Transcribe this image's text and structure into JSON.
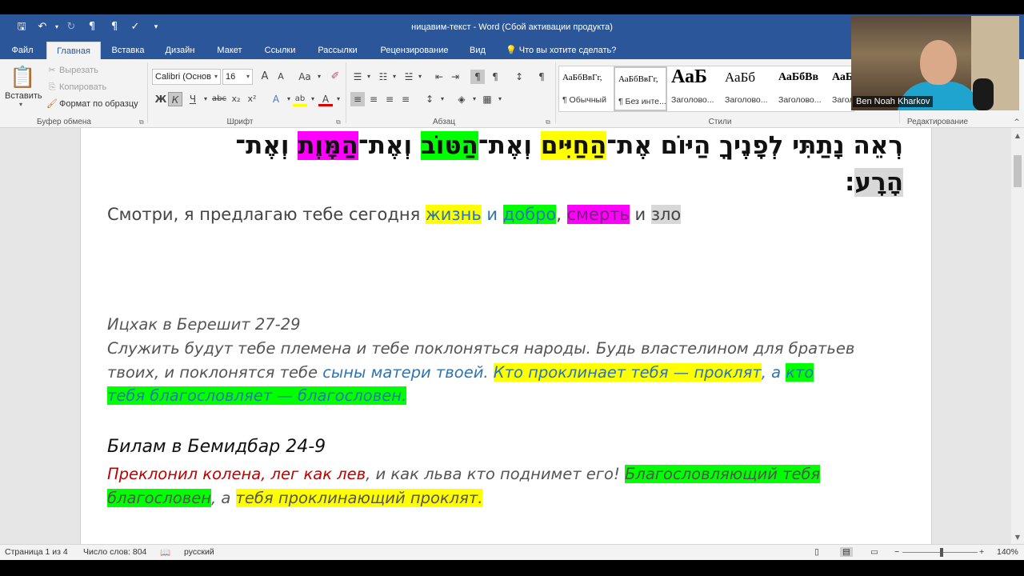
{
  "titlebar": {
    "title": "ницавим-текст - Word (Сбой активации продукта)"
  },
  "tabs": [
    {
      "label": "Файл"
    },
    {
      "label": "Главная"
    },
    {
      "label": "Вставка"
    },
    {
      "label": "Дизайн"
    },
    {
      "label": "Макет"
    },
    {
      "label": "Ссылки"
    },
    {
      "label": "Рассылки"
    },
    {
      "label": "Рецензирование"
    },
    {
      "label": "Вид"
    }
  ],
  "tell_me": "Что вы хотите сделать?",
  "clipboard": {
    "paste": "Вставить",
    "cut": "Вырезать",
    "copy": "Копировать",
    "format_painter": "Формат по образцу",
    "group": "Буфер обмена"
  },
  "font": {
    "name": "Calibri (Основ",
    "size": "16",
    "group": "Шрифт",
    "bold": "Ж",
    "italic": "К",
    "underline": "Ч",
    "strike": "abc",
    "sub": "x₂",
    "sup": "x²",
    "grow": "A",
    "shrink": "A",
    "case": "Аа",
    "text_effects": "A",
    "highlight": "ab",
    "font_color": "A"
  },
  "paragraph": {
    "group": "Абзац"
  },
  "styles": {
    "group": "Стили",
    "items": [
      {
        "sample": "АаБбВвГг,",
        "name": "¶ Обычный"
      },
      {
        "sample": "АаБбВвГг,",
        "name": "¶ Без инте..."
      },
      {
        "sample": "АаБ",
        "name": "Заголово..."
      },
      {
        "sample": "АаБб",
        "name": "Заголово..."
      },
      {
        "sample": "АаБбВв",
        "name": "Заголово..."
      },
      {
        "sample": "АаБ",
        "name": "Загол"
      }
    ]
  },
  "editing": {
    "group": "Редактирование"
  },
  "webcam": {
    "name": "Ben Noah Kharkov"
  },
  "document": {
    "hebrew": {
      "line1": {
        "p1": "רְאֵה נָתַתִּי לְפָנֶיךָ הַיּוֹם אֶת־",
        "p2": "הַחַיִּים",
        "p3": " וְאֶת־",
        "p4": "הַטּוֹב",
        "p5": " וְאֶת־",
        "p6": "הַמָּוֶת",
        "p7": " וְאֶת־"
      },
      "line2": {
        "p1": "הָרָע",
        "p2": ":"
      }
    },
    "translation": {
      "p1": "Смотри, я предлагаю тебе сегодня ",
      "p2": "жизнь",
      "p3": " и ",
      "p4": "добро",
      "p5": ", ",
      "p6": "смерть",
      "p7": " и ",
      "p8": "зло"
    },
    "isaac": {
      "heading": "Ицхак в Берешит 27-29",
      "line1": "Служить будут тебе племена и тебе поклоняться народы. Будь властелином для братьев",
      "line2": {
        "p1": "твоих, и поклонятся тебе ",
        "p2": "сыны матери твоей. ",
        "p3": "Кто проклинает тебя — проклят",
        "p4": ", а ",
        "p5": "кто"
      },
      "line3": "тебя благословляет — благословен."
    },
    "bilam": {
      "heading": "Билам в Бемидбар 24-9",
      "line1": {
        "p1": "Преклонил колена, лег как лев",
        "p2": ", и как льва кто поднимет его! ",
        "p3": "Благословляющий тебя"
      },
      "line2": {
        "p1": "благословен",
        "p2": ", а ",
        "p3": "тебя проклинающий проклят."
      }
    }
  },
  "statusbar": {
    "page": "Страница 1 из 4",
    "words": "Число слов: 804",
    "language": "русский",
    "zoom": "140%"
  },
  "colors": {
    "ribbon_blue": "#2b579a",
    "highlight_yellow": "#ffff00",
    "highlight_green": "#00ff00",
    "highlight_magenta": "#ff00ff",
    "highlight_gray": "#d8d8d8",
    "text_blue": "#2e74b5",
    "text_red": "#c00000"
  }
}
